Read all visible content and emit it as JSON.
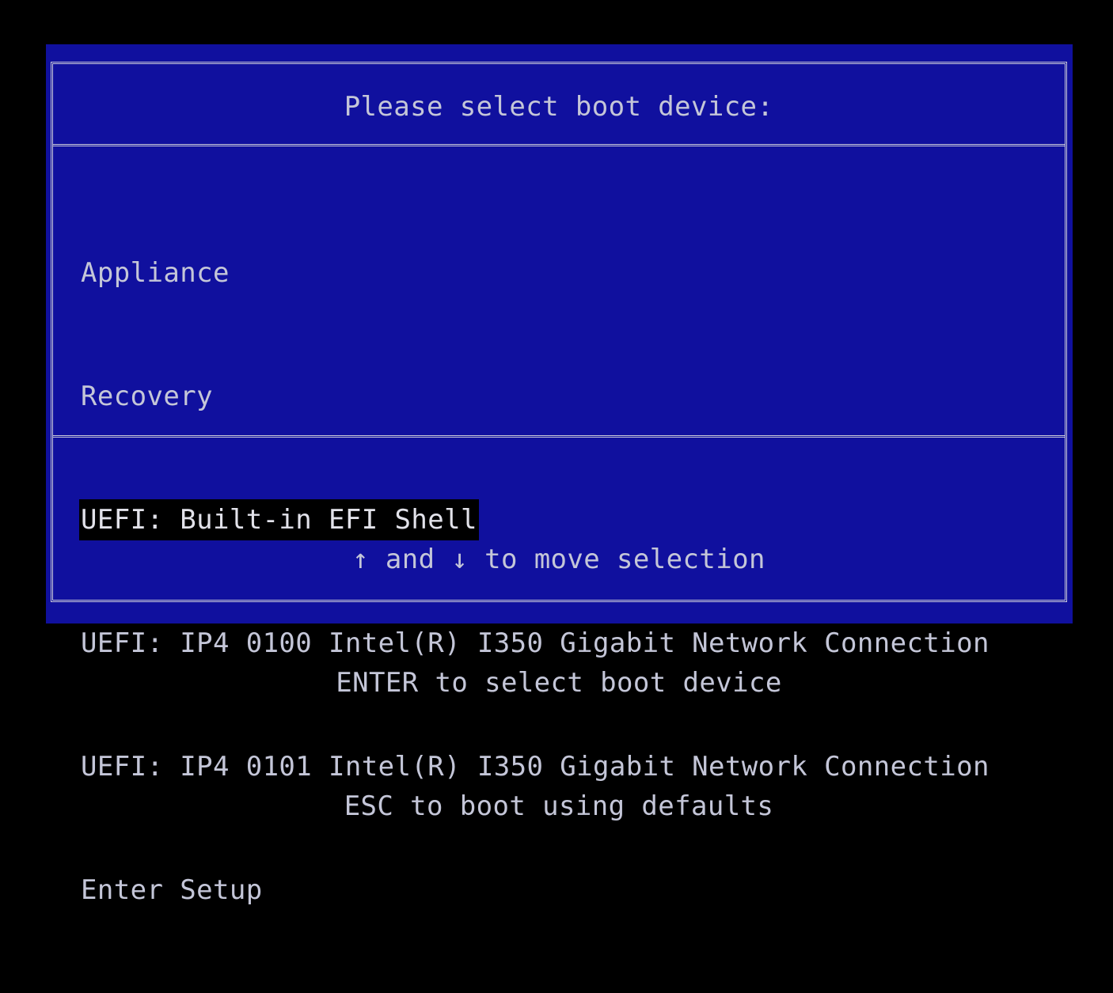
{
  "title": "Please select boot device:",
  "menu": {
    "selected_index": 2,
    "items": [
      {
        "label": "Appliance"
      },
      {
        "label": "Recovery"
      },
      {
        "label": "UEFI: Built-in EFI Shell"
      },
      {
        "label": "UEFI: IP4 0100 Intel(R) I350 Gigabit Network Connection"
      },
      {
        "label": "UEFI: IP4 0101 Intel(R) I350 Gigabit Network Connection"
      },
      {
        "label": "Enter Setup"
      }
    ]
  },
  "help": {
    "line1": "↑ and ↓ to move selection",
    "line2": "ENTER to select boot device",
    "line3": "ESC to boot using defaults"
  },
  "colors": {
    "background": "#000000",
    "panel": "#10109e",
    "text": "#c4c6d8",
    "selection_bg": "#000000"
  }
}
